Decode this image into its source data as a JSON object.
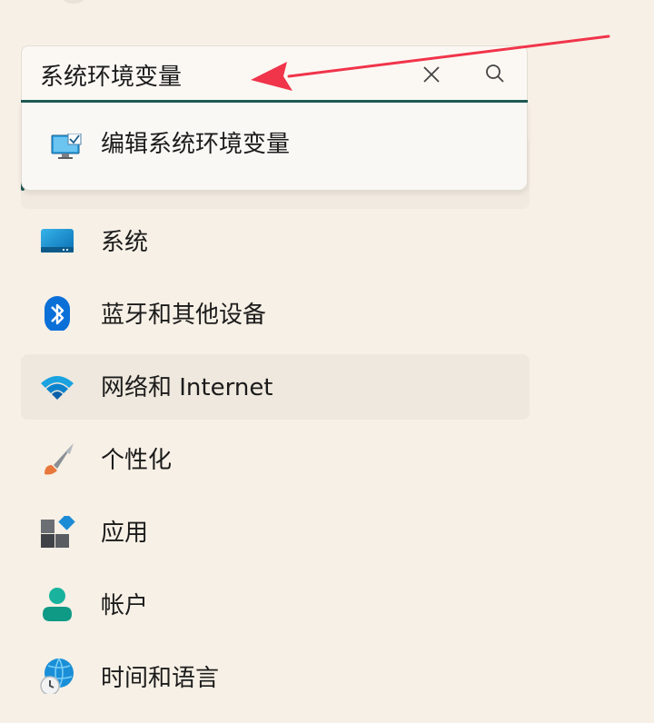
{
  "search": {
    "value": "系统环境变量",
    "clear_icon": "close-icon",
    "search_icon": "search-icon"
  },
  "suggestion": {
    "label": "编辑系统环境变量",
    "icon": "monitor-settings-icon"
  },
  "nav": {
    "items": [
      {
        "label": "系统",
        "icon": "system-display-icon"
      },
      {
        "label": "蓝牙和其他设备",
        "icon": "bluetooth-icon"
      },
      {
        "label": "网络和 Internet",
        "icon": "wifi-icon",
        "selected": true
      },
      {
        "label": "个性化",
        "icon": "paintbrush-icon"
      },
      {
        "label": "应用",
        "icon": "apps-icon"
      },
      {
        "label": "帐户",
        "icon": "account-icon"
      },
      {
        "label": "时间和语言",
        "icon": "globe-clock-icon"
      }
    ]
  },
  "colors": {
    "accent": "#1e5a54",
    "annotation": "#f0344a",
    "background": "#f7f0e6"
  }
}
